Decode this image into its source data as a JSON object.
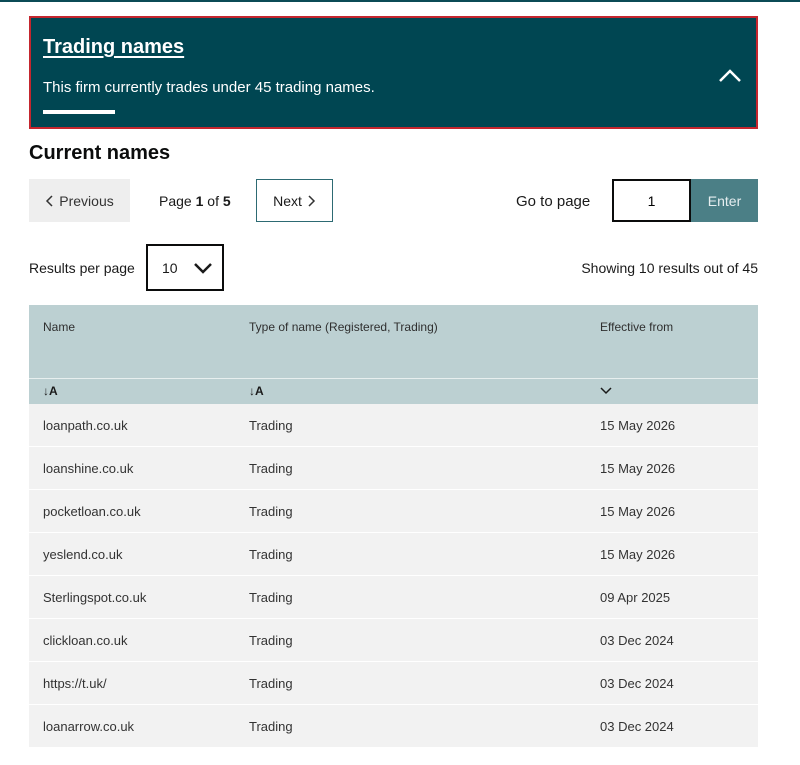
{
  "banner": {
    "title": "Trading names",
    "description": "This firm currently trades under 45 trading names.",
    "icon": "chevron-up-icon"
  },
  "section_title": "Current names",
  "pagination": {
    "previous_label": "Previous",
    "next_label": "Next",
    "page_prefix": "Page ",
    "current_page": "1",
    "of_label": " of ",
    "total_pages": "5",
    "goto_label": "Go to page",
    "goto_value": "1",
    "enter_label": "Enter"
  },
  "results": {
    "per_page_label": "Results per page",
    "per_page_value": "10",
    "showing_text": "Showing 10 results out of 45"
  },
  "table": {
    "columns": [
      "Name",
      "Type of name (Registered, Trading)",
      "Effective from"
    ],
    "sort_controls": [
      "↓A",
      "↓A",
      "chevron-down-icon"
    ],
    "rows": [
      [
        "loanpath.co.uk",
        "Trading",
        "15 May 2026"
      ],
      [
        "loanshine.co.uk",
        "Trading",
        "15 May 2026"
      ],
      [
        "pocketloan.co.uk",
        "Trading",
        "15 May 2026"
      ],
      [
        "yeslend.co.uk",
        "Trading",
        "15 May 2026"
      ],
      [
        "Sterlingspot.co.uk",
        "Trading",
        "09 Apr 2025"
      ],
      [
        "clickloan.co.uk",
        "Trading",
        "03 Dec 2024"
      ],
      [
        "https://t.uk/",
        "Trading",
        "03 Dec 2024"
      ],
      [
        "loanarrow.co.uk",
        "Trading",
        "03 Dec 2024"
      ]
    ]
  },
  "colors": {
    "banner_bg": "#004652",
    "banner_border": "#c4262e",
    "table_header_bg": "#bcd0d2",
    "row_bg": "#f2f2f2",
    "enter_button_bg": "#4b7f86"
  }
}
